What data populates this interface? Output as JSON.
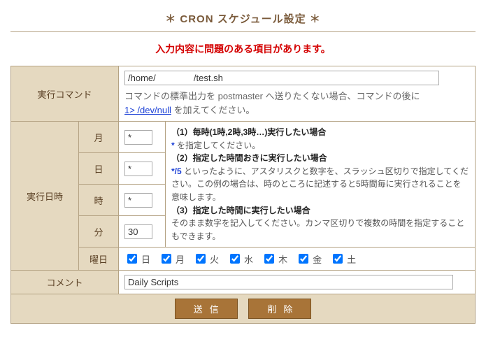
{
  "title": "＊ CRON スケジュール設定 ＊",
  "error": "入力内容に問題のある項目があります。",
  "labels": {
    "command": "実行コマンド",
    "datetime": "実行日時",
    "month": "月",
    "day": "日",
    "hour": "時",
    "minute": "分",
    "weekday": "曜日",
    "comment": "コメント"
  },
  "command": {
    "value": "/home/               /test.sh",
    "hint_prefix": "コマンドの標準出力を postmaster へ送りたくない場合、コマンドの後に",
    "hint_link": "1> /dev/null",
    "hint_suffix": " を加えてください。"
  },
  "time": {
    "month": "*",
    "day": "*",
    "hour": "*",
    "minute": "30"
  },
  "desc": {
    "h1": "（1）毎時(1時,2時,3時…)実行したい場合",
    "t1a": "*",
    "t1b": " を指定してください。",
    "h2": "（2）指定した時間おきに実行したい場合",
    "t2a": "*/5",
    "t2b": " といったように、アスタリスクと数字を、スラッシュ区切りで指定してください。この例の場合は、時のところに記述すると5時間毎に実行されることを意味します。",
    "h3": "（3）指定した時間に実行したい場合",
    "t3": "そのまま数字を記入してください。カンマ区切りで複数の時間を指定することもできます。"
  },
  "weekdays": [
    "日",
    "月",
    "火",
    "水",
    "木",
    "金",
    "土"
  ],
  "comment": "Daily Scripts",
  "buttons": {
    "submit": "送信",
    "delete": "削除"
  }
}
